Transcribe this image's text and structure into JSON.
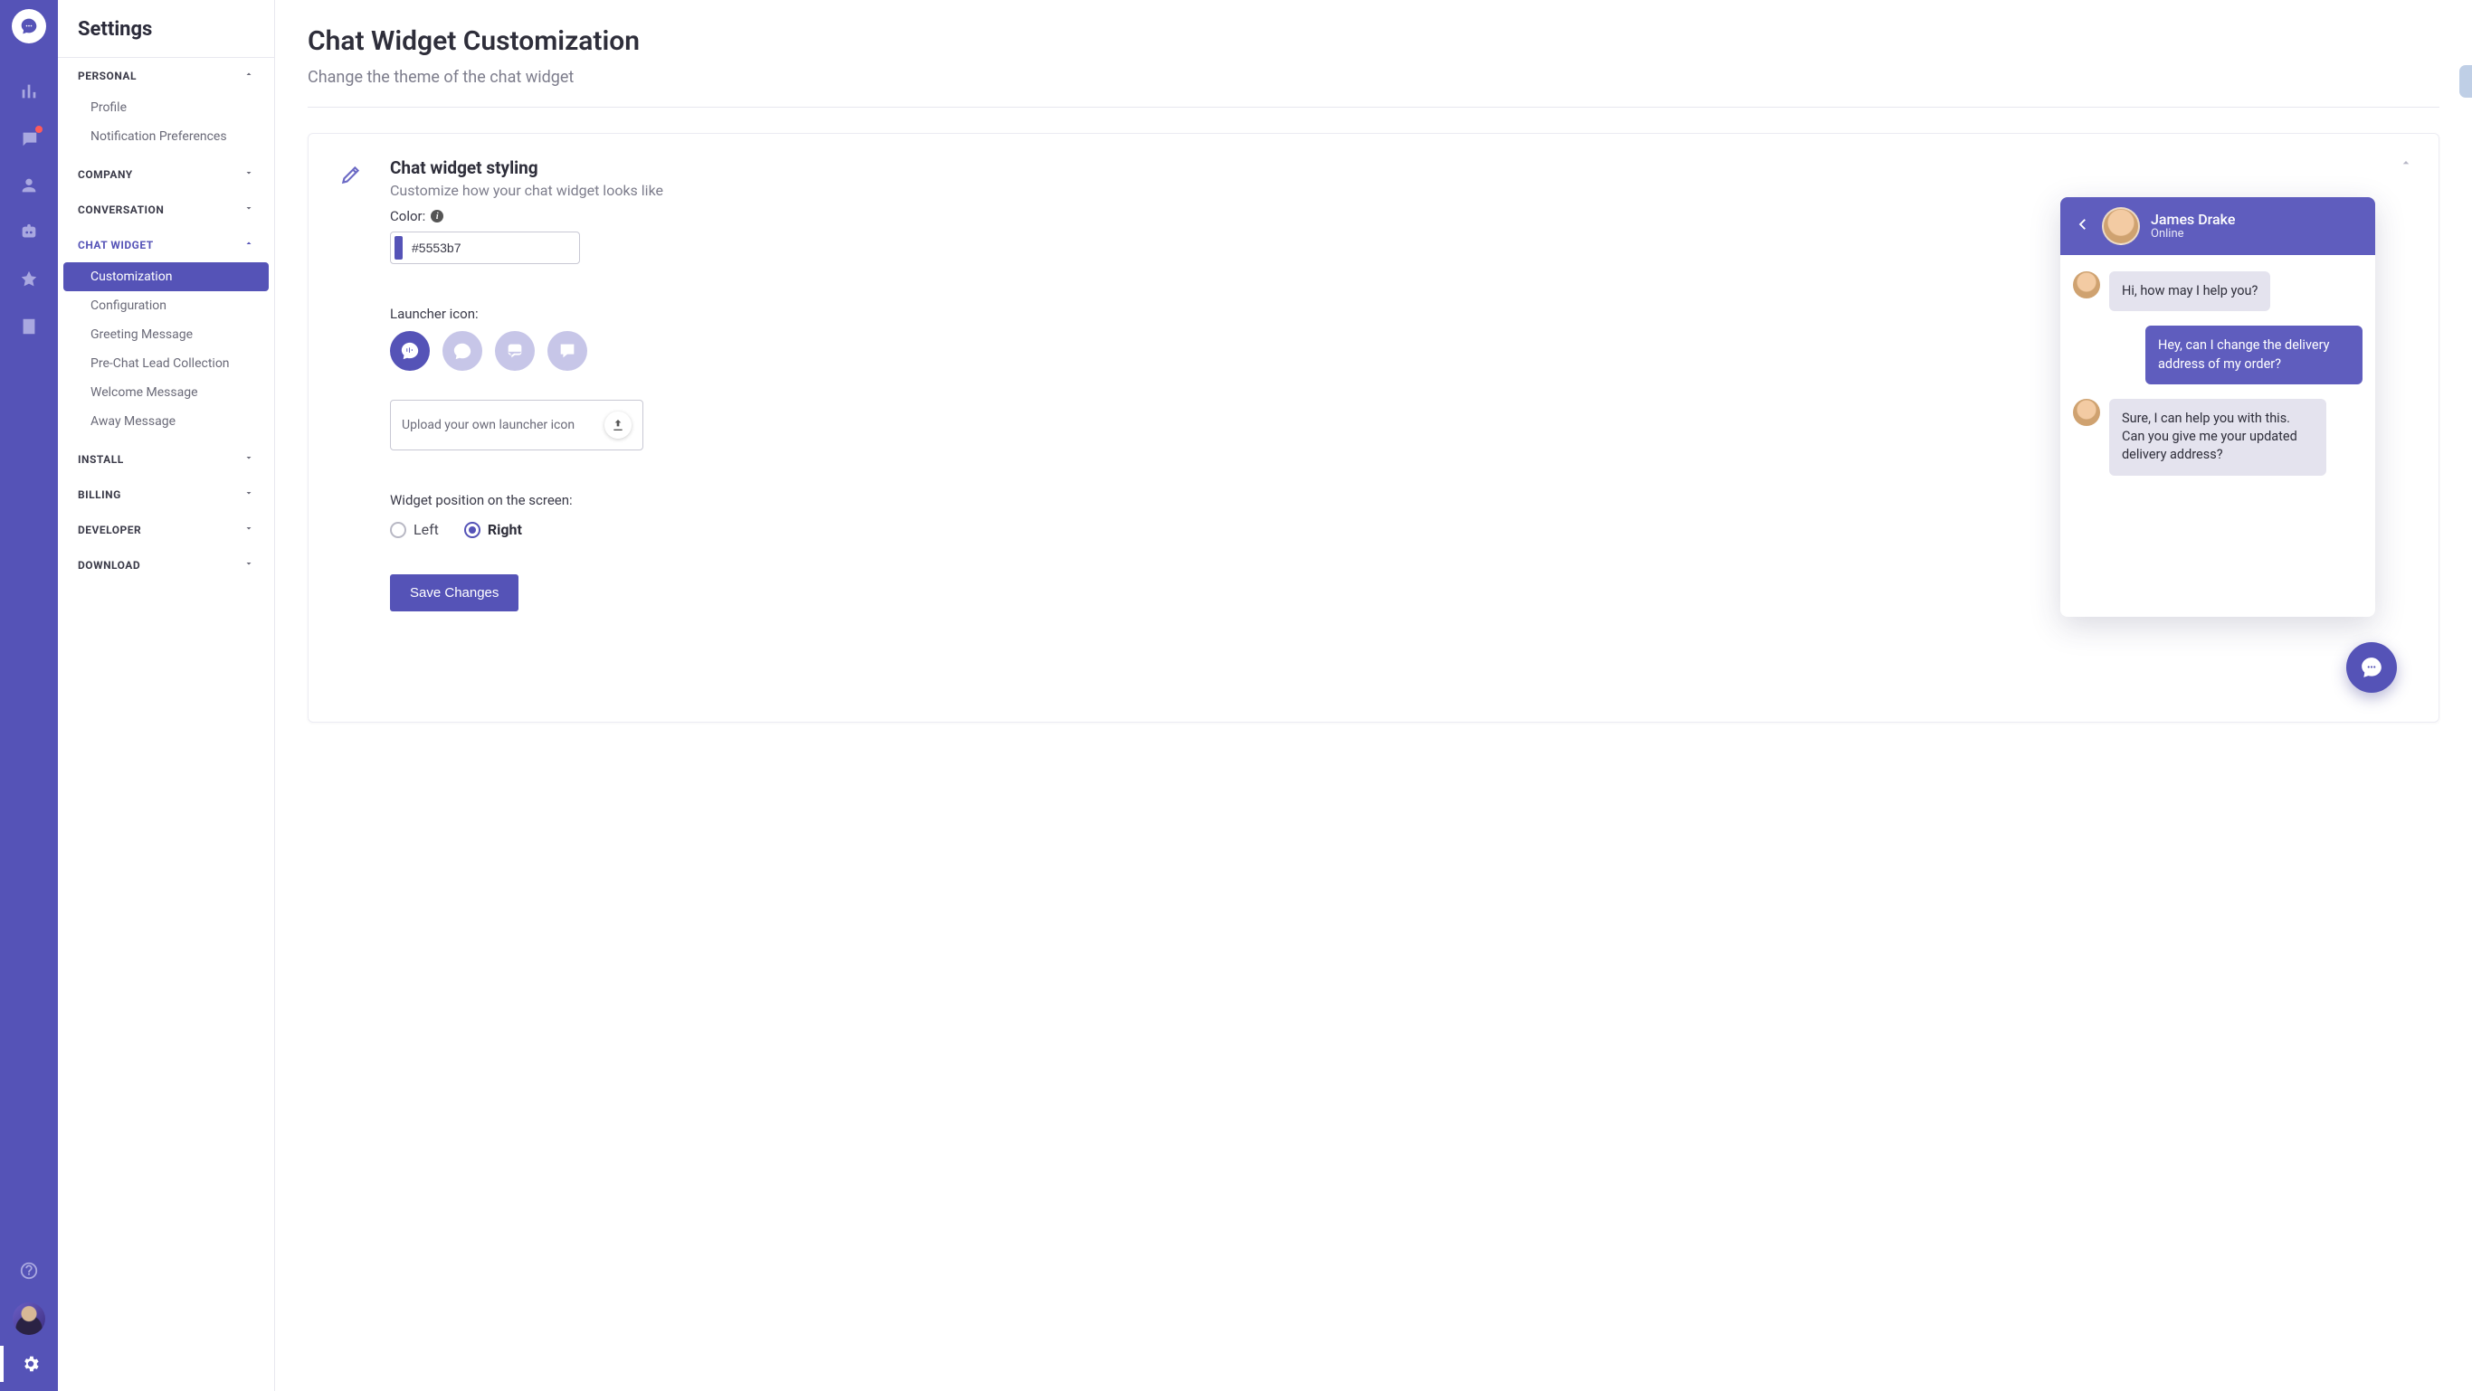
{
  "colors": {
    "accent": "#5553b7"
  },
  "rail": {
    "icons": [
      "analytics",
      "inbox",
      "contacts",
      "bot",
      "launch",
      "notes"
    ],
    "help": "help",
    "settings": "settings"
  },
  "sidebar": {
    "title": "Settings",
    "sections": [
      {
        "key": "personal",
        "label": "Personal",
        "expanded": true,
        "items": [
          {
            "label": "Profile"
          },
          {
            "label": "Notification Preferences"
          }
        ]
      },
      {
        "key": "company",
        "label": "Company",
        "expanded": false,
        "items": []
      },
      {
        "key": "conversation",
        "label": "Conversation",
        "expanded": false,
        "items": []
      },
      {
        "key": "chat_widget",
        "label": "Chat Widget",
        "expanded": true,
        "active": true,
        "items": [
          {
            "label": "Customization",
            "active": true
          },
          {
            "label": "Configuration"
          },
          {
            "label": "Greeting Message"
          },
          {
            "label": "Pre-Chat Lead Collection"
          },
          {
            "label": "Welcome Message"
          },
          {
            "label": "Away Message"
          }
        ]
      },
      {
        "key": "install",
        "label": "Install",
        "expanded": false,
        "items": []
      },
      {
        "key": "billing",
        "label": "Billing",
        "expanded": false,
        "items": []
      },
      {
        "key": "developer",
        "label": "Developer",
        "expanded": false,
        "items": []
      },
      {
        "key": "download",
        "label": "Download",
        "expanded": false,
        "items": []
      }
    ]
  },
  "page": {
    "title": "Chat Widget Customization",
    "subtitle": "Change the theme of the chat widget"
  },
  "styling": {
    "heading": "Chat widget styling",
    "subheading": "Customize how your chat widget looks like",
    "color_label": "Color:",
    "color_value": "#5553b7",
    "launcher_label": "Launcher icon:",
    "launcher_icons": [
      "equalizer-bubble",
      "speech-bubble",
      "double-bubble",
      "square-bubble"
    ],
    "launcher_selected": 0,
    "upload_label": "Upload your own launcher icon",
    "position_label": "Widget position on the screen:",
    "position_options": [
      {
        "label": "Left",
        "value": "left",
        "selected": false
      },
      {
        "label": "Right",
        "value": "right",
        "selected": true
      }
    ],
    "save_label": "Save Changes"
  },
  "preview": {
    "agent_name": "James Drake",
    "status": "Online",
    "messages": [
      {
        "from": "agent",
        "text": "Hi, how may I help you?"
      },
      {
        "from": "user",
        "text": "Hey, can I change the delivery address of my order?"
      },
      {
        "from": "agent",
        "text": "Sure, I can help you with this. Can you give me your updated delivery address?"
      }
    ]
  }
}
